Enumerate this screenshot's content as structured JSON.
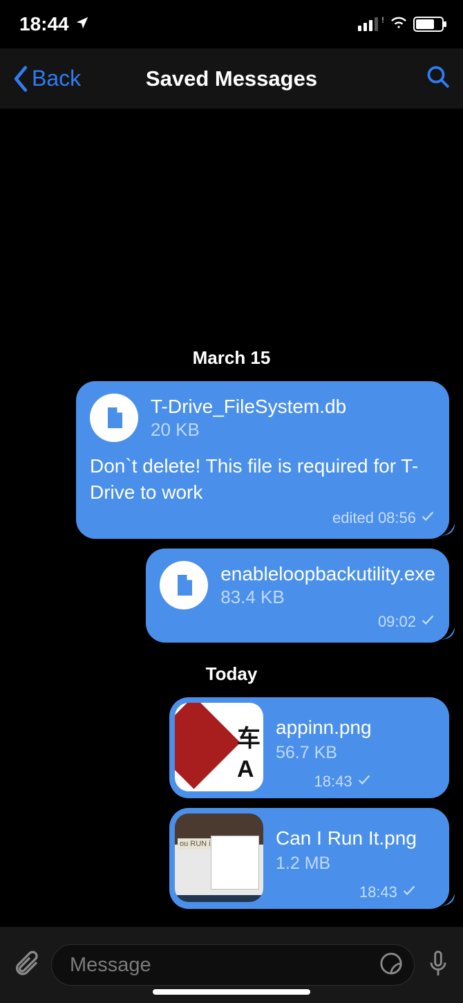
{
  "status": {
    "time": "18:44"
  },
  "nav": {
    "back_label": "Back",
    "title": "Saved Messages"
  },
  "dates": {
    "d1": "March 15",
    "d2": "Today"
  },
  "messages": [
    {
      "file_name": "T-Drive_FileSystem.db",
      "file_size": "20 KB",
      "text": "Don`t delete! This file is required for T-Drive to work",
      "edited_label": "edited",
      "time": "08:56"
    },
    {
      "file_name": "enableloopbackutility.exe",
      "file_size": "83.4 KB",
      "time": "09:02"
    },
    {
      "file_name": "appinn.png",
      "file_size": "56.7 KB",
      "time": "18:43"
    },
    {
      "file_name": "Can I Run It.png",
      "file_size": "1.2 MB",
      "time": "18:43",
      "thumb_tag": "ou RUN it"
    }
  ],
  "input": {
    "placeholder": "Message"
  }
}
